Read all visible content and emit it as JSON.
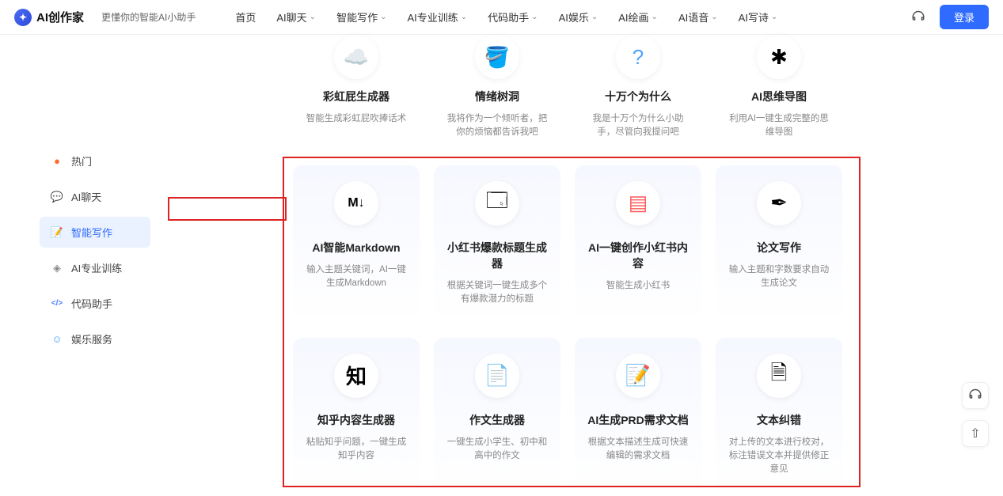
{
  "header": {
    "logo": "AI创作家",
    "slogan": "更懂你的智能AI小助手",
    "nav": [
      "首页",
      "AI聊天",
      "智能写作",
      "AI专业训练",
      "代码助手",
      "AI娱乐",
      "AI绘画",
      "AI语音",
      "AI写诗"
    ],
    "login": "登录"
  },
  "sidebar": {
    "items": [
      {
        "icon": "🔥",
        "label": "热门"
      },
      {
        "icon": "💬",
        "label": "AI聊天"
      },
      {
        "icon": "📝",
        "label": "智能写作"
      },
      {
        "icon": "🧊",
        "label": "AI专业训练"
      },
      {
        "icon": "</>",
        "label": "代码助手"
      },
      {
        "icon": "😊",
        "label": "娱乐服务"
      }
    ]
  },
  "top_row": [
    {
      "icon": "🌈",
      "title": "彩虹屁生成器",
      "desc": "智能生成彩虹屁吹捧话术"
    },
    {
      "icon": "🪣",
      "title": "情绪树洞",
      "desc": "我将作为一个倾听者，把你的烦恼都告诉我吧"
    },
    {
      "icon": "❓",
      "title": "十万个为什么",
      "desc": "我是十万个为什么小助手，尽管向我提问吧"
    },
    {
      "icon": "🧠",
      "title": "AI思维导图",
      "desc": "利用AI一键生成完整的思维导图"
    }
  ],
  "grid": [
    {
      "icon": "M↓",
      "title": "AI智能Markdown",
      "desc": "输入主题关键词，AI一键生成Markdown"
    },
    {
      "icon": "🗔",
      "title": "小红书爆款标题生成器",
      "desc": "根据关键词一键生成多个有爆款潜力的标题"
    },
    {
      "icon": "📕",
      "title": "AI一键创作小红书内容",
      "desc": "智能生成小红书"
    },
    {
      "icon": "✒️",
      "title": "论文写作",
      "desc": "输入主题和字数要求自动生成论文"
    },
    {
      "icon": "知",
      "title": "知乎内容生成器",
      "desc": "粘贴知乎问题，一键生成知乎内容"
    },
    {
      "icon": "📄",
      "title": "作文生成器",
      "desc": "一键生成小学生、初中和高中的作文"
    },
    {
      "icon": "📝",
      "title": "AI生成PRD需求文档",
      "desc": "根据文本描述生成可快速编辑的需求文档"
    },
    {
      "icon": "🗑️",
      "title": "文本纠错",
      "desc": "对上传的文本进行校对，标注错误文本并提供修正意见"
    }
  ]
}
